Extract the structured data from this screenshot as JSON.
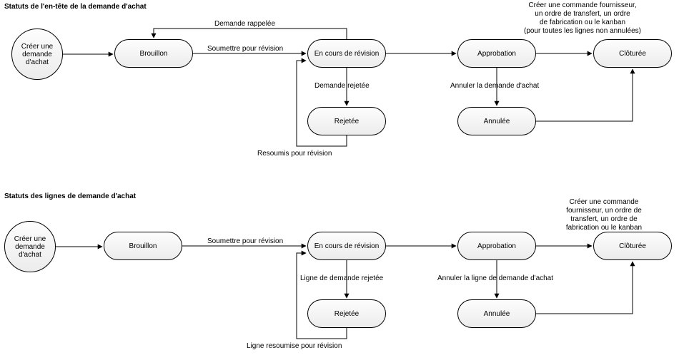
{
  "headings": {
    "h1": "Statuts de l'en-tête de la demande d'achat",
    "h2": "Statuts des lignes de demande d'achat"
  },
  "nodes": {
    "start1": "Créer une demande d'achat",
    "draft1": "Brouillon",
    "review1": "En cours de révision",
    "rejected1": "Rejetée",
    "approval1": "Approbation",
    "cancelled1": "Annulée",
    "closed1": "Clôturée",
    "start2": "Créer une demande d'achat",
    "draft2": "Brouillon",
    "review2": "En cours de révision",
    "rejected2": "Rejetée",
    "approval2": "Approbation",
    "cancelled2": "Annulée",
    "closed2": "Clôturée"
  },
  "labels": {
    "recalled": "Demande rappelée",
    "submit1": "Soumettre pour révision",
    "rejectedReq": "Demande rejetée",
    "resubmit1": "Resoumis pour révision",
    "cancelReq": "Annuler la demande d'achat",
    "createOrder1": "Créer une commande fournisseur,\nun ordre de transfert, un ordre\nde fabrication ou le kanban\n(pour toutes les lignes non annulées)",
    "submit2": "Soumettre pour révision",
    "lineRejected": "Ligne de demande rejetée",
    "lineResubmit": "Ligne resoumise pour révision",
    "cancelLine": "Annuler la ligne de demande d'achat",
    "createOrder2": "Créer une commande\nfournisseur, un ordre de\ntransfert, un ordre de\nfabrication ou le kanban"
  }
}
